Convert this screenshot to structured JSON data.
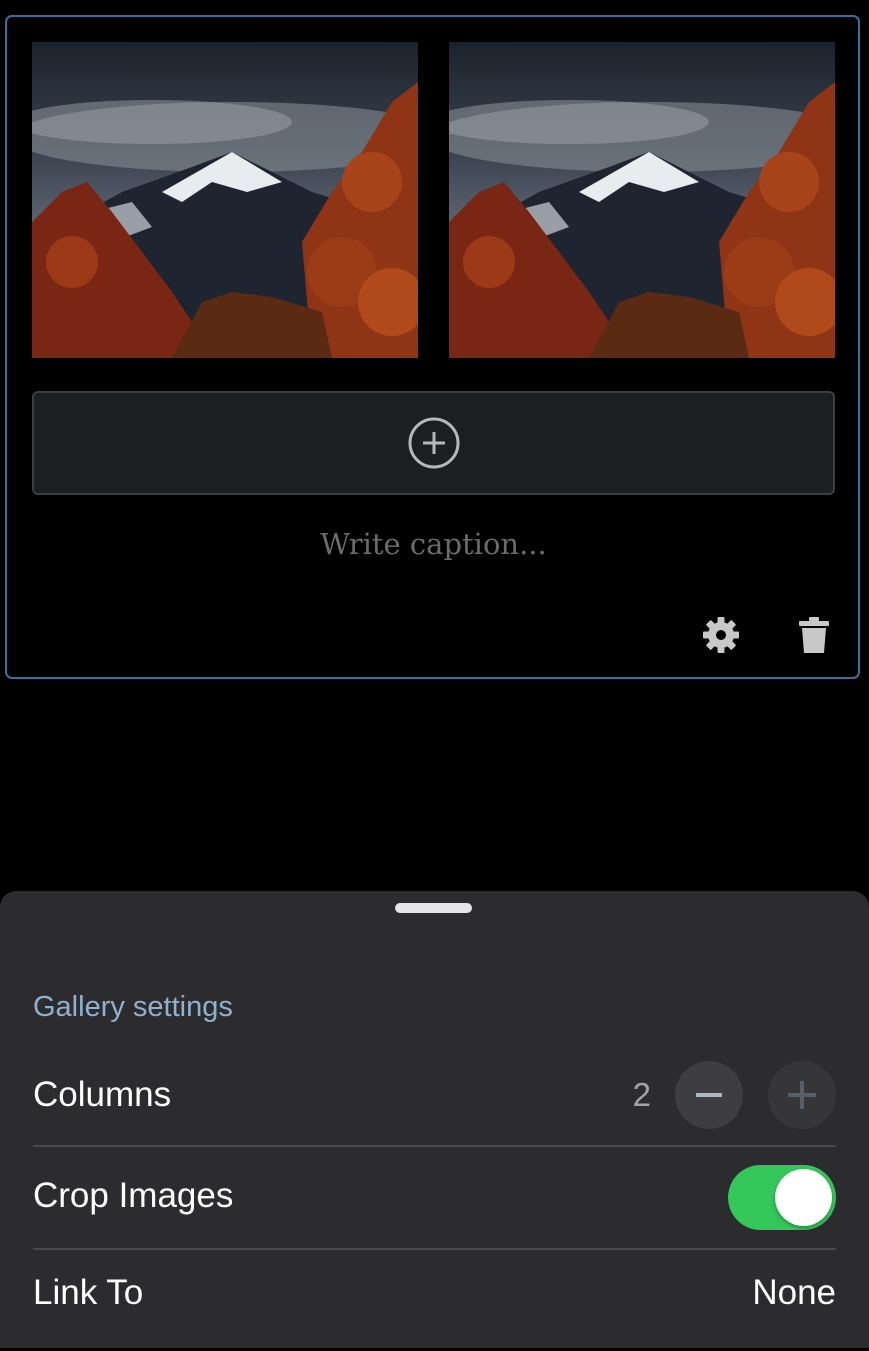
{
  "gallery": {
    "images": [
      {
        "alt": "",
        "subject": "mountain-autumn-photo"
      },
      {
        "alt": "",
        "subject": "mountain-autumn-photo"
      }
    ],
    "caption_placeholder": "Write caption..."
  },
  "icons": {
    "add": "plus-circle-icon",
    "settings": "gear-icon",
    "delete": "trash-icon"
  },
  "settings_sheet": {
    "title": "Gallery settings",
    "columns": {
      "label": "Columns",
      "value": "2"
    },
    "crop_images": {
      "label": "Crop Images",
      "enabled": true
    },
    "link_to": {
      "label": "Link To",
      "value": "None"
    }
  },
  "colors": {
    "accent_border": "#3d6f9c",
    "section_title": "#8fb1cf",
    "toggle_on": "#34c759",
    "sheet_background": "#2c2c2e"
  }
}
